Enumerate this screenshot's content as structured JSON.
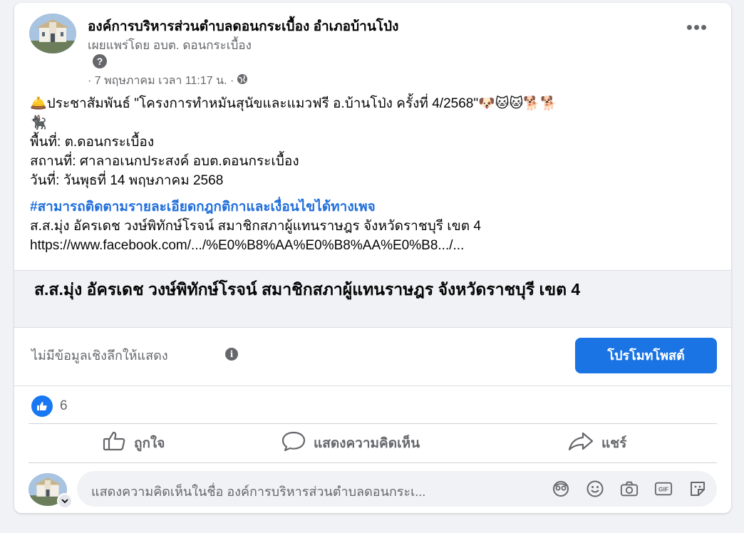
{
  "post": {
    "page_name": "องค์การบริหารส่วนตำบลดอนกระเบื้อง อำเภอบ้านโป่ง",
    "published_by": "เผยแพร่โดย อบต. ดอนกระเบื้อง",
    "help_symbol": "?",
    "meta_date": "· 7 พฤษภาคม เวลา 11:17 น. ·",
    "more_label": "•••",
    "body": {
      "headline_emoji": "🛎️",
      "headline": "ประชาสัมพันธ์ \"โครงการทำหมันสุนัขและแมวฟรี อ.บ้านโป่ง ครั้งที่ 4/2568\"",
      "headline_trailing_emoji": "🐶🐱🐱🐕🐕",
      "line2_emoji": "🐈‍⬛",
      "area": "พื้นที่: ต.ดอนกระเบื้อง",
      "place": "สถานที่: ศาลาอเนกประสงค์ อบต.ดอนกระเบื้อง",
      "date": "วันที่: วันพุธที่ 14 พฤษภาคม 2568",
      "hashtag": "#สามารถติดตามรายละเอียดกฎกติกาและเงื่อนไขได้ทางเพจ",
      "mp_line": "ส.ส.มุ่ง อัครเดช วงษ์พิทักษ์โรจน์ สมาชิกสภาผู้แทนราษฎร จังหวัดราชบุรี เขต 4",
      "url": "https://www.facebook.com/.../%E0%B8%AA%E0%B8%AA%E0%B8.../..."
    },
    "link_preview_title": "ส.ส.มุ่ง อัครเดช วงษ์พิทักษ์โรจน์ สมาชิกสภาผู้แทนราษฎร จังหวัดราชบุรี เขต 4",
    "insights_text": "ไม่มีข้อมูลเชิงลึกให้แสดง",
    "info_symbol": "i",
    "promote_label": "โปรโมทโพสต์",
    "like_count": "6",
    "actions": {
      "like": "ถูกใจ",
      "comment": "แสดงความคิดเห็น",
      "share": "แชร์"
    },
    "comment_placeholder": "แสดงความคิดเห็นในชื่อ องค์การบริหารส่วนตำบลดอนกระเ...",
    "icons": {
      "globe": "globe-icon",
      "like": "thumbs-up-icon",
      "comment": "speech-bubble-icon",
      "share": "share-arrow-icon",
      "tools": [
        "avatar-sticker-icon",
        "emoji-icon",
        "camera-icon",
        "gif-icon",
        "sticker-icon"
      ]
    },
    "colors": {
      "accent": "#1b74e4",
      "hashtag": "#216fdb",
      "secondary_text": "#65676b",
      "background": "#f0f2f5"
    }
  }
}
